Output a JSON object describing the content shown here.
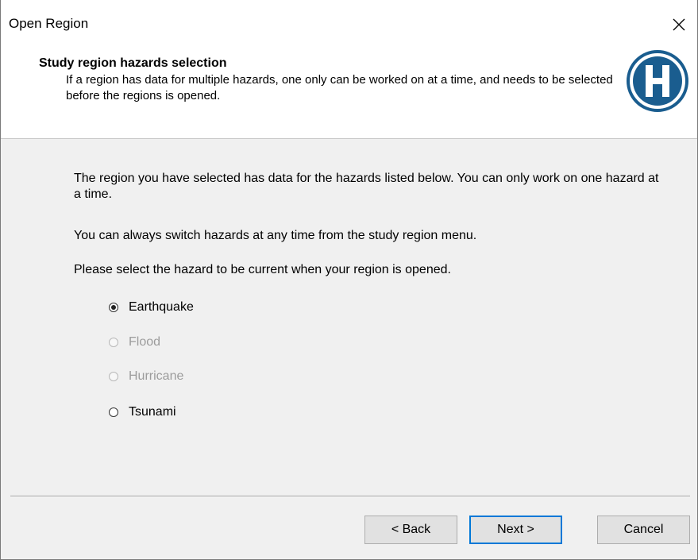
{
  "window": {
    "title": "Open Region"
  },
  "header": {
    "title": "Study region hazards selection",
    "description": "If a region has data for multiple hazards, one only can be worked on at a time, and needs to be selected before the regions is opened."
  },
  "content": {
    "para1": "The region you have selected has data for the hazards listed below.  You can only work on one hazard at a time.",
    "para2": "You can always switch hazards at any time from the study region menu.",
    "para3": "Please select the hazard to be current when your region is opened."
  },
  "hazards": [
    {
      "label": "Earthquake",
      "selected": true,
      "enabled": true
    },
    {
      "label": "Flood",
      "selected": false,
      "enabled": false
    },
    {
      "label": "Hurricane",
      "selected": false,
      "enabled": false
    },
    {
      "label": "Tsunami",
      "selected": false,
      "enabled": true
    }
  ],
  "buttons": {
    "back": "< Back",
    "next": "Next >",
    "cancel": "Cancel"
  },
  "colors": {
    "logo_blue": "#1a5d8f",
    "accent": "#0078d7"
  },
  "icons": {
    "close": "close-icon",
    "logo": "hazus-logo-icon"
  }
}
